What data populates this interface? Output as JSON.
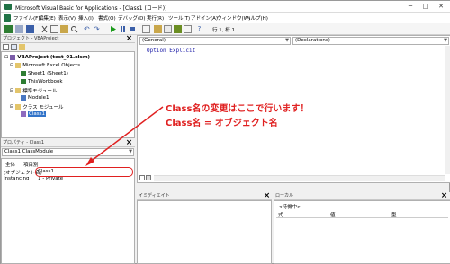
{
  "window": {
    "title": "Microsoft Visual Basic for Applications - [Class1 (コード)]",
    "minimize": "─",
    "maximize": "□",
    "close": "✕"
  },
  "menu": [
    "ファイル(F)",
    "編集(E)",
    "表示(V)",
    "挿入(I)",
    "書式(O)",
    "デバッグ(D)",
    "実行(R)",
    "ツール(T)",
    "アドイン(A)",
    "ウィンドウ(W)",
    "ヘルプ(H)"
  ],
  "toolbar": {
    "position_text": "行 1, 桁 1"
  },
  "project": {
    "title": "プロジェクト - VBAProject",
    "root": "VBAProject (test_01.xlsm)",
    "folder_excel": "Microsoft Excel Objects",
    "sheet1": "Sheet1 (Sheet1)",
    "thisworkbook": "ThisWorkbook",
    "folder_std": "標準モジュール",
    "module1": "Module1",
    "folder_class": "クラス モジュール",
    "class1": "Class1"
  },
  "properties": {
    "title": "プロパティ - Class1",
    "object_select": "Class1 ClassModule",
    "tab_all": "全体",
    "tab_category": "項目別",
    "rows": [
      {
        "name": "(オブジェクト名)",
        "value": "Class1"
      },
      {
        "name": "Instancing",
        "value": "1 - Private"
      }
    ]
  },
  "code": {
    "object_dropdown": "(General)",
    "proc_dropdown": "(Declarations)",
    "line1": "Option Explicit"
  },
  "callout": {
    "line1": "Class名の変更はここで行います！",
    "line2": "Class名 = オブジェクト名"
  },
  "immediate": {
    "title": "イミディエイト"
  },
  "locals": {
    "title": "ローカル",
    "status": "<待機中>",
    "col_expr": "式",
    "col_value": "値",
    "col_type": "型"
  },
  "colors": {
    "accent_red": "#e02020",
    "code_blue": "#1a1aa6"
  }
}
